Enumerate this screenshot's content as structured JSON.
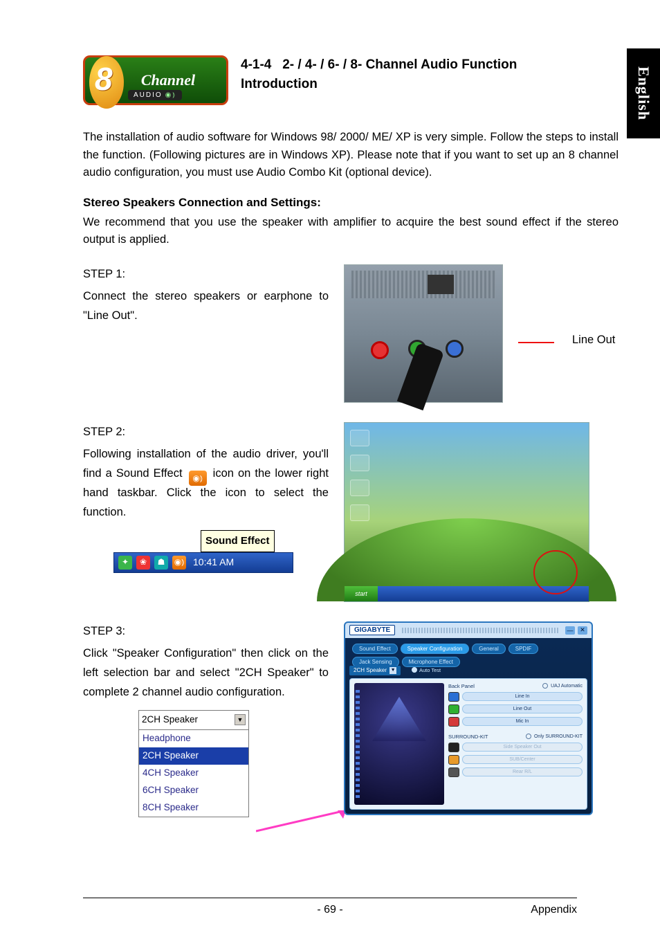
{
  "side_tab": "English",
  "heading": {
    "num": "4-1-4",
    "title_l1": "2- / 4- / 6- / 8- Channel Audio Function",
    "title_l2": "Introduction"
  },
  "logo": {
    "text": "Channel",
    "badge": "AUDIO"
  },
  "intro": "The installation of audio software for Windows 98/ 2000/ ME/ XP is very simple. Follow the steps to install the function. (Following pictures are in Windows XP). Please note that if you want to set up an 8 channel audio configuration, you must use Audio Combo Kit (optional device).",
  "subhead": "Stereo Speakers Connection and Settings:",
  "subpara": "We recommend that you use the speaker with amplifier to acquire the best sound effect if the stereo output is applied.",
  "step1": {
    "label": "STEP 1:",
    "text": "Connect the stereo speakers or earphone to \"Line Out\".",
    "callout": "Line Out"
  },
  "step2": {
    "label": "STEP 2:",
    "pre": "Following installation of the audio driver, you'll find a Sound Effect ",
    "post": " icon on the lower right hand taskbar. Click the icon to select the function.",
    "tooltip": "Sound Effect",
    "clock": "10:41 AM",
    "desktop_start": "start"
  },
  "step3": {
    "label": "STEP 3:",
    "text": "Click \"Speaker Configuration\" then click on the left selection bar and select \"2CH Speaker\" to complete 2 channel audio configuration.",
    "dropdown": {
      "selected": "2CH Speaker",
      "options": [
        "Headphone",
        "2CH Speaker",
        "4CH Speaker",
        "6CH Speaker",
        "8CH Speaker"
      ],
      "highlight_index": 1
    }
  },
  "config": {
    "brand": "GIGABYTE",
    "tabs": [
      "Sound Effect",
      "Speaker Configuration",
      "General",
      "SPDIF",
      "Jack Sensing",
      "Microphone Effect"
    ],
    "active_tab_index": 1,
    "sel_speaker": "2CH Speaker",
    "auto_test": "Auto Test",
    "back_panel": "Back Panel",
    "uaj": "UAJ Automatic",
    "opts_top": [
      "Line In",
      "Line Out",
      "Mic In"
    ],
    "surround_kit": "SURROUND-KIT",
    "only_skit": "Only SURROUND-KIT",
    "opts_bottom": [
      "Side Speaker Out",
      "SUB/Center",
      "Rear R/L"
    ]
  },
  "footer": {
    "page": "- 69 -",
    "section": "Appendix"
  }
}
